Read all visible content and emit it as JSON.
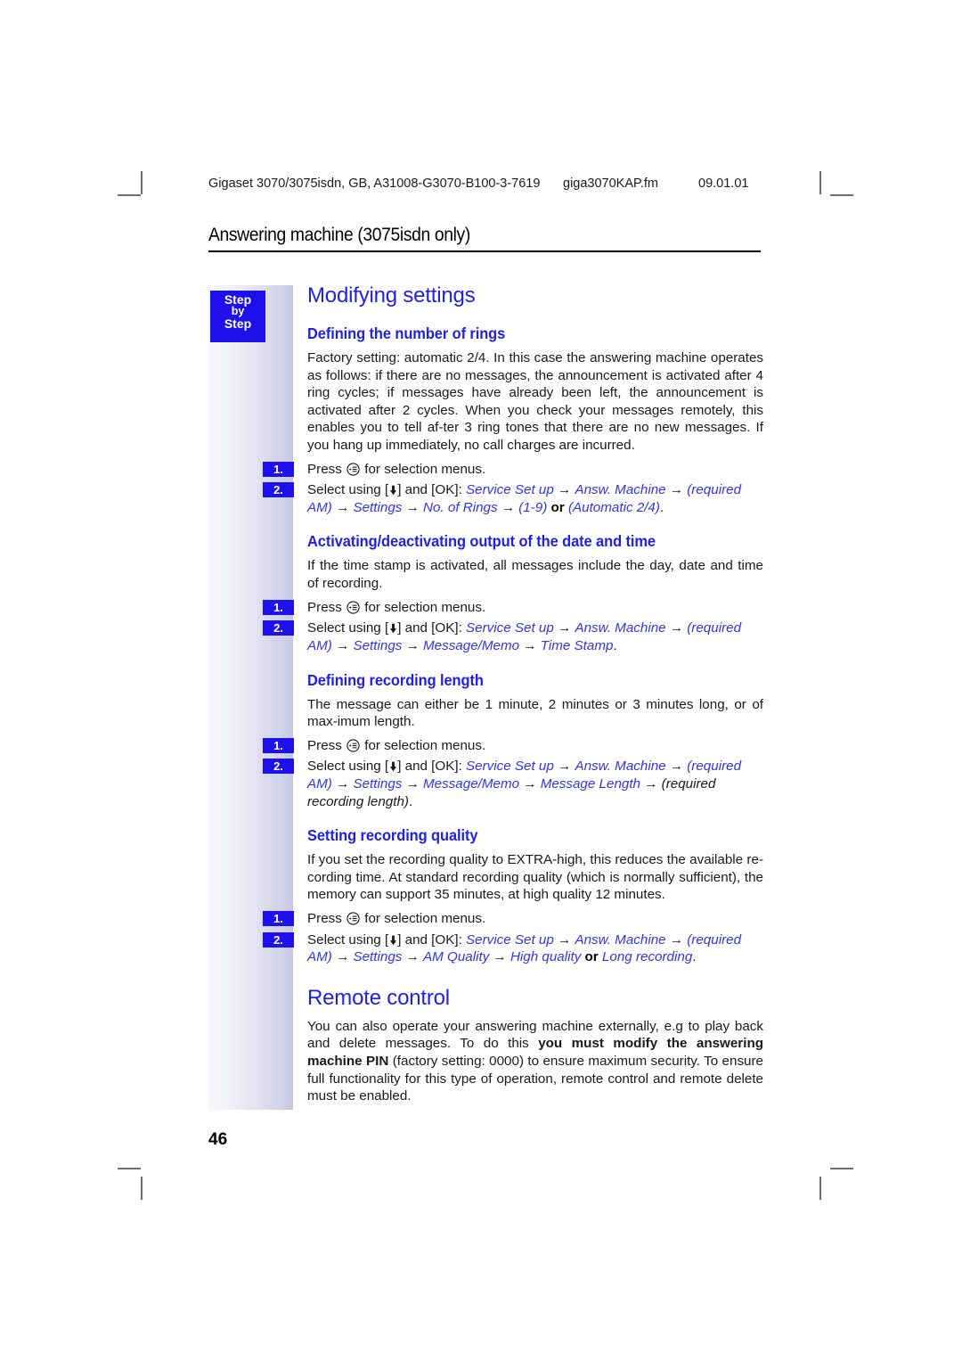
{
  "running_head": {
    "document": "Gigaset 3070/3075isdn, GB, A31008-G3070-B100-3-7619",
    "filename": "giga3070KAP.fm",
    "date": "09.01.01"
  },
  "chapter_header": "Answering machine (3075isdn only)",
  "step_badge": {
    "line1": "Step",
    "line2": "by",
    "line3": "Step"
  },
  "colors": {
    "heading_blue": "#2020e8",
    "menu_blue": "#3333ee",
    "badge_blue": "#1d10ea",
    "band_light": "#f7f7fc",
    "band_dark": "#c6c6e2"
  },
  "icons": {
    "menu_key": "menu-key-icon",
    "down_key": "down-arrow-key-icon"
  },
  "section_title": "Modifying settings",
  "subsections": [
    {
      "id": "number-of-rings",
      "title": "Defining the number of rings",
      "intro": "Factory setting: automatic 2/4. In this case the answering machine operates as follows: if there are no messages, the announcement is activated after 4 ring cycles; if messages have already been left, the announcement is activated after 2 cycles. When you check your messages remotely, this enables you to tell af-ter 3 ring tones that there are no new messages. If you hang up immediately, no call charges are incurred.",
      "steps": [
        {
          "num": "1.",
          "pre": "Press ",
          "post": " for selection menus."
        },
        {
          "num": "2.",
          "pre": "Select using [",
          "mid": "] and [OK]: "
        }
      ],
      "path": [
        {
          "t": "Service Set up",
          "s": "menu"
        },
        {
          "t": " → ",
          "s": "arrow"
        },
        {
          "t": "Answ. Machine",
          "s": "menu"
        },
        {
          "t": " → ",
          "s": "arrow"
        },
        {
          "t": "(required AM)",
          "s": "menu"
        },
        {
          "t": " → ",
          "s": "arrow"
        },
        {
          "t": "Settings",
          "s": "menu"
        },
        {
          "t": " → ",
          "s": "arrow"
        },
        {
          "t": "No. of Rings",
          "s": "menu"
        },
        {
          "t": " → ",
          "s": "arrow"
        },
        {
          "t": "(1-9)",
          "s": "menu"
        },
        {
          "t": " or ",
          "s": "or"
        },
        {
          "t": "(Automatic 2/4)",
          "s": "menu"
        },
        {
          "t": ".",
          "s": "arrow"
        }
      ]
    },
    {
      "id": "date-time-output",
      "title": "Activating/deactivating output of the date and time",
      "intro": "If the time stamp is activated, all messages include the day, date and time of recording.",
      "steps": [
        {
          "num": "1.",
          "pre": "Press ",
          "post": " for selection menus."
        },
        {
          "num": "2.",
          "pre": "Select using [",
          "mid": "] and [OK]: "
        }
      ],
      "path": [
        {
          "t": "Service Set up",
          "s": "menu"
        },
        {
          "t": " → ",
          "s": "arrow"
        },
        {
          "t": "Answ. Machine",
          "s": "menu"
        },
        {
          "t": " → ",
          "s": "arrow"
        },
        {
          "t": "(required AM)",
          "s": "menu"
        },
        {
          "t": " → ",
          "s": "arrow"
        },
        {
          "t": "Settings",
          "s": "menu"
        },
        {
          "t": " → ",
          "s": "arrow"
        },
        {
          "t": "Message/Memo",
          "s": "menu"
        },
        {
          "t": " → ",
          "s": "arrow"
        },
        {
          "t": "Time Stamp",
          "s": "menu"
        },
        {
          "t": ".",
          "s": "arrow"
        }
      ]
    },
    {
      "id": "recording-length",
      "title": "Defining recording length",
      "intro": "The message can either be 1 minute, 2 minutes or 3 minutes long, or of max-imum length.",
      "steps": [
        {
          "num": "1.",
          "pre": "Press ",
          "post": " for selection menus."
        },
        {
          "num": "2.",
          "pre": "Select using [",
          "mid": "] and [OK]: "
        }
      ],
      "path": [
        {
          "t": "Service Set up",
          "s": "menu"
        },
        {
          "t": " → ",
          "s": "arrow"
        },
        {
          "t": "Answ. Machine",
          "s": "menu"
        },
        {
          "t": " → ",
          "s": "arrow"
        },
        {
          "t": "(required AM)",
          "s": "menu"
        },
        {
          "t": " → ",
          "s": "arrow"
        },
        {
          "t": "Settings",
          "s": "menu"
        },
        {
          "t": " → ",
          "s": "arrow"
        },
        {
          "t": "Message/Memo",
          "s": "menu"
        },
        {
          "t": " → ",
          "s": "arrow"
        },
        {
          "t": "Message Length",
          "s": "menu"
        },
        {
          "t": " → ",
          "s": "arrow"
        },
        {
          "t": "(required recording length)",
          "s": "ital"
        },
        {
          "t": ".",
          "s": "arrow"
        }
      ]
    },
    {
      "id": "recording-quality",
      "title": "Setting recording quality",
      "intro": "If you set the recording quality to EXTRA-high, this reduces the available re-cording time. At standard recording quality (which is normally sufficient), the memory can support 35 minutes, at high quality 12 minutes.",
      "steps": [
        {
          "num": "1.",
          "pre": "Press ",
          "post": " for selection menus."
        },
        {
          "num": "2.",
          "pre": "Select using [",
          "mid": "] and [OK]: "
        }
      ],
      "path": [
        {
          "t": "Service Set up",
          "s": "menu"
        },
        {
          "t": " → ",
          "s": "arrow"
        },
        {
          "t": "Answ. Machine",
          "s": "menu"
        },
        {
          "t": " → ",
          "s": "arrow"
        },
        {
          "t": "(required AM)",
          "s": "menu"
        },
        {
          "t": " → ",
          "s": "arrow"
        },
        {
          "t": "Settings",
          "s": "menu"
        },
        {
          "t": " → ",
          "s": "arrow"
        },
        {
          "t": "AM Quality",
          "s": "menu"
        },
        {
          "t": " → ",
          "s": "arrow"
        },
        {
          "t": "High quality",
          "s": "menu"
        },
        {
          "t": " or ",
          "s": "or"
        },
        {
          "t": "Long recording",
          "s": "menu"
        },
        {
          "t": ".",
          "s": "arrow"
        }
      ]
    }
  ],
  "remote_control": {
    "title": "Remote control",
    "para_a": "You can also operate your answering machine externally, e.g to play back and delete messages. To do this ",
    "para_bold": "you must modify the answering machine PIN",
    "para_b": " (factory setting: 0000) to ensure maximum security. To ensure full functionality for this type of operation, remote control and remote delete must be enabled."
  },
  "page_number": "46"
}
